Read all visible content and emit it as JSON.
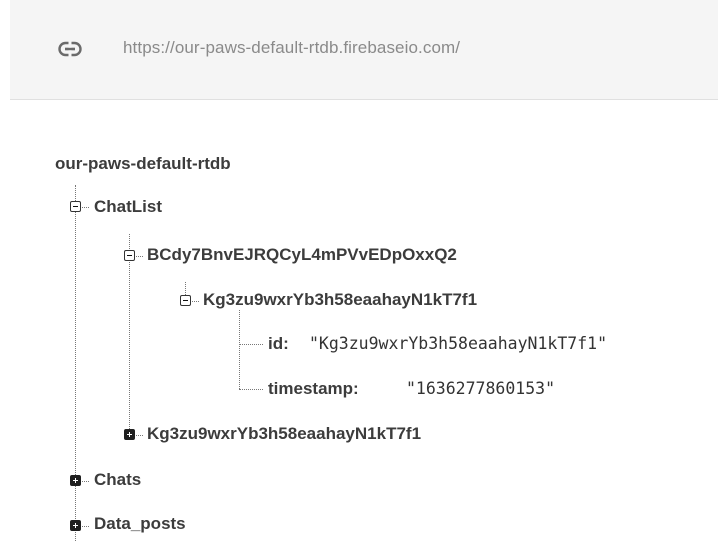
{
  "url_bar": {
    "icon": "link-icon",
    "url": "https://our-paws-default-rtdb.firebaseio.com/"
  },
  "tree": {
    "root": "our-paws-default-rtdb",
    "chatlist": {
      "label": "ChatList",
      "expanded": true,
      "user": {
        "label": "BCdy7BnvEJRQCyL4mPVvEDpOxxQ2",
        "expanded": true,
        "chat": {
          "label": "Kg3zu9wxrYb3h58eaahayN1kT7f1",
          "expanded": true,
          "fields": [
            {
              "key": "id:",
              "value": "\"Kg3zu9wxrYb3h58eaahayN1kT7f1\""
            },
            {
              "key": "timestamp:",
              "value": "\"1636277860153\""
            }
          ]
        }
      },
      "collapsed_child": "Kg3zu9wxrYb3h58eaahayN1kT7f1"
    },
    "chats": "Chats",
    "data_posts": "Data_posts"
  }
}
